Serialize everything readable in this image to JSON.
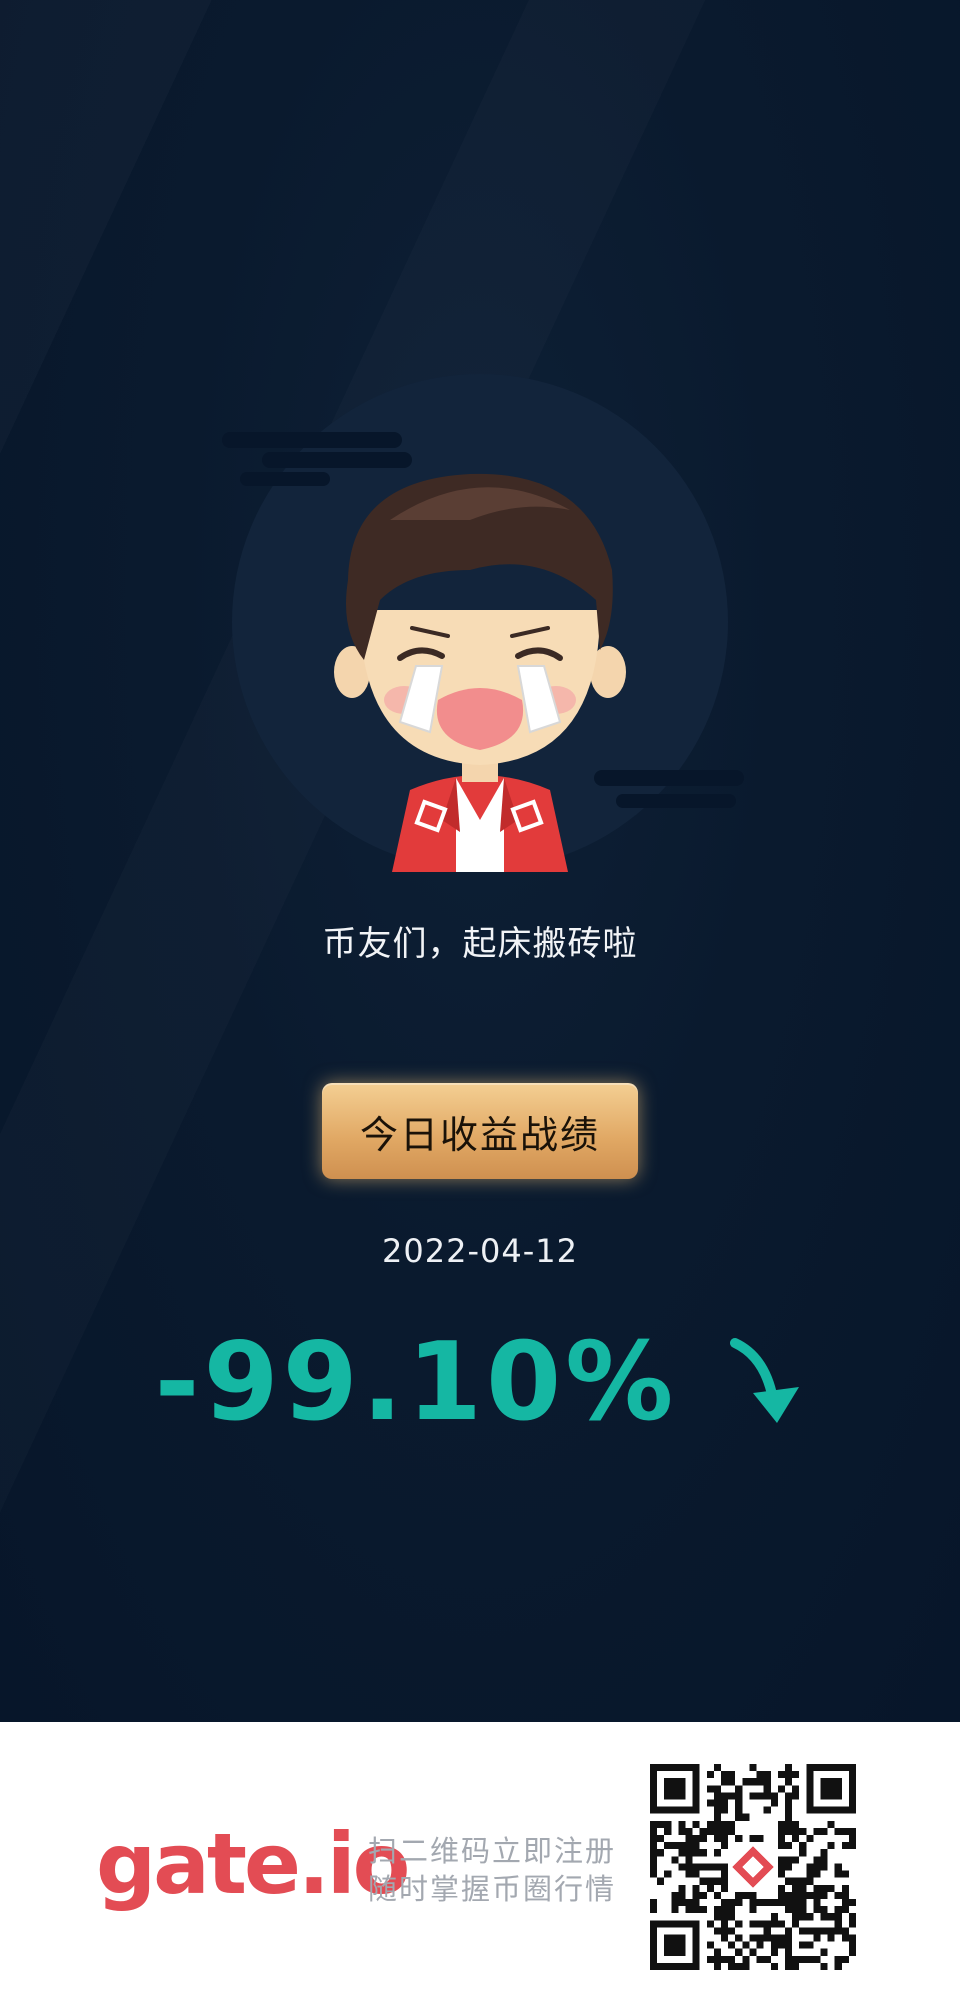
{
  "caption": "币友们，起床搬砖啦",
  "badge_label": "今日收益战绩",
  "date": "2022-04-12",
  "change": {
    "value": "-99.10%",
    "direction": "down",
    "color": "#15b7a3"
  },
  "footer": {
    "brand": "gate.io",
    "brand_color": "#e34c54",
    "slogan_line1": "扫二维码立即注册",
    "slogan_line2": "随时掌握币圈行情"
  },
  "icons": {
    "avatar": "crying-cartoon-man-avatar",
    "trend": "down-arrow-icon",
    "qr": "qr-code"
  }
}
